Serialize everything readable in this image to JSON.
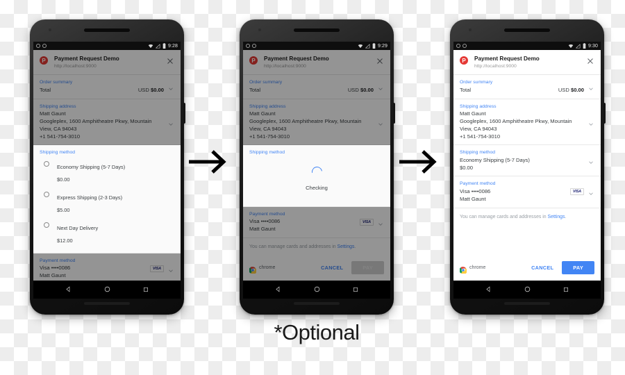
{
  "caption": "*Optional",
  "icons": {
    "arrow": "arrow-right-icon",
    "close": "close-icon",
    "chevron": "chevron-down-icon",
    "wifi": "wifi-icon",
    "signal": "signal-icon",
    "battery": "battery-icon",
    "chrome": "chrome-logo-icon",
    "back": "nav-back-icon",
    "home": "nav-home-icon",
    "recents": "nav-recents-icon",
    "spinner": "loading-spinner-icon"
  },
  "colors": {
    "accent": "#4285f4",
    "favicon": "#e53935",
    "visa": "#1a1f71",
    "muted": "#9aa0a6",
    "text": "#3c4043"
  },
  "sheet": {
    "favicon_letter": "P",
    "title": "Payment Request Demo",
    "url": "http://localhost:9000",
    "order_summary_label": "Order summary",
    "total_label": "Total",
    "total_currency": "USD",
    "total_amount": "$0.00",
    "shipping_address_label": "Shipping address",
    "shipping_address_lines": [
      "Matt Gaunt",
      "Googleplex, 1600 Amphitheatre Pkwy, Mountain",
      "View, CA 94043",
      "+1 541-754-3010"
    ],
    "shipping_method_label": "Shipping method",
    "payment_method_label": "Payment method",
    "payment_card": "Visa  ••••0086",
    "payment_name": "Matt Gaunt",
    "visa_badge": "VISA",
    "manage_text_before": "You can manage cards and addresses in ",
    "manage_link": "Settings",
    "manage_text_after": ".",
    "chrome_label": "chrome",
    "cancel_label": "CANCEL",
    "pay_label": "PAY"
  },
  "phones": [
    {
      "id": "phone-1",
      "status_time": "9:28",
      "state": "shipping-method-selection",
      "shipping_options": [
        {
          "title": "Economy Shipping (5-7 Days)",
          "price": "$0.00",
          "selected": false
        },
        {
          "title": "Express Shipping (2-3 Days)",
          "price": "$5.00",
          "selected": false
        },
        {
          "title": "Next Day Delivery",
          "price": "$12.00",
          "selected": false
        }
      ],
      "pay_enabled": false
    },
    {
      "id": "phone-2",
      "status_time": "9:29",
      "state": "checking",
      "checking_label": "Checking",
      "pay_enabled": false
    },
    {
      "id": "phone-3",
      "status_time": "9:30",
      "state": "ready-to-pay",
      "selected_shipping_title": "Economy Shipping (5-7 Days)",
      "selected_shipping_price": "$0.00",
      "pay_enabled": true
    }
  ]
}
